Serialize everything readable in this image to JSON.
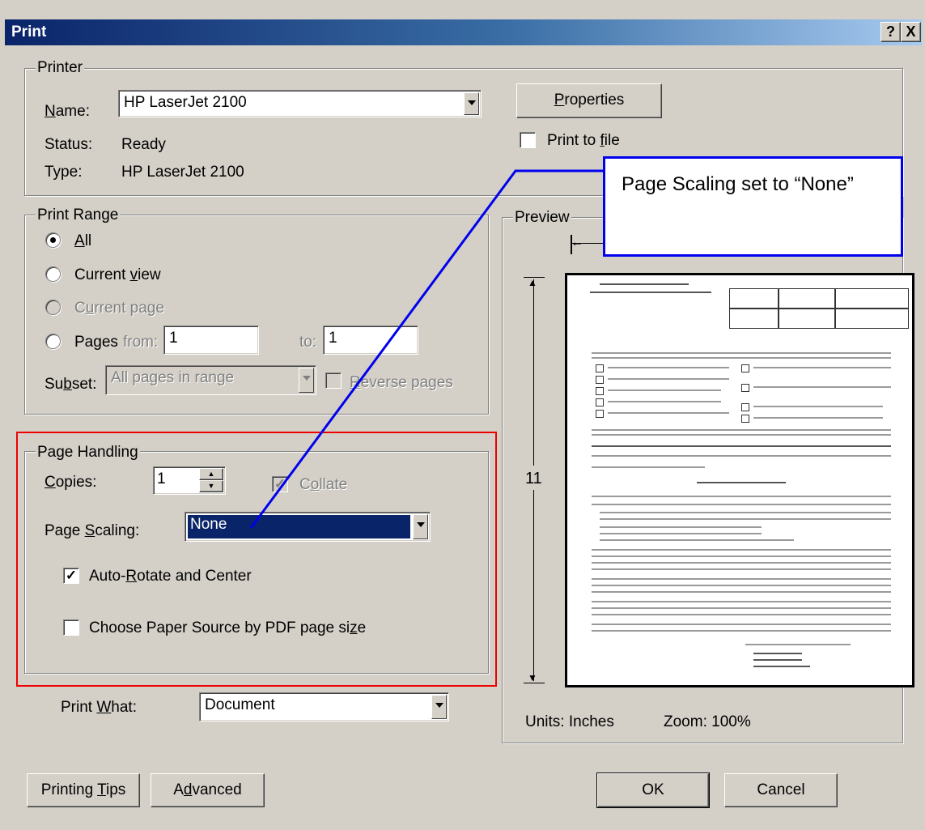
{
  "window": {
    "title": "Print",
    "help_label": "?",
    "close_label": "X"
  },
  "printer": {
    "group_label": "Printer",
    "name_label": "Name:",
    "name_value": "HP LaserJet 2100",
    "status_label": "Status:",
    "status_value": "Ready",
    "type_label": "Type:",
    "type_value": "HP LaserJet 2100",
    "properties_label": "Properties",
    "print_to_file_label": "Print to file",
    "print_to_file_checked": false
  },
  "print_range": {
    "group_label": "Print Range",
    "all_label": "All",
    "current_view_label": "Current view",
    "current_page_label": "Current page",
    "pages_label": "Pages",
    "from_label": "from:",
    "from_value": "1",
    "to_label": "to:",
    "to_value": "1",
    "subset_label": "Subset:",
    "subset_value": "All pages in range",
    "reverse_label": "Reverse pages",
    "selected": "All"
  },
  "page_handling": {
    "group_label": "Page Handling",
    "copies_label": "Copies:",
    "copies_value": "1",
    "collate_label": "Collate",
    "collate_checked": true,
    "page_scaling_label": "Page Scaling:",
    "page_scaling_value": "None",
    "auto_rotate_label": "Auto-Rotate and Center",
    "auto_rotate_checked": true,
    "paper_source_label": "Choose Paper Source by PDF page size",
    "paper_source_checked": false
  },
  "print_what": {
    "label": "Print What:",
    "value": "Document"
  },
  "preview": {
    "group_label": "Preview",
    "height_dim": "11",
    "units_label": "Units: Inches",
    "zoom_label": "Zoom: 100%"
  },
  "buttons": {
    "printing_tips": "Printing Tips",
    "advanced": "Advanced",
    "ok": "OK",
    "cancel": "Cancel"
  },
  "annotation": {
    "callout_text": "Page Scaling set to “None”",
    "callout_color": "#0000ee",
    "highlight_color": "#ee0000"
  }
}
